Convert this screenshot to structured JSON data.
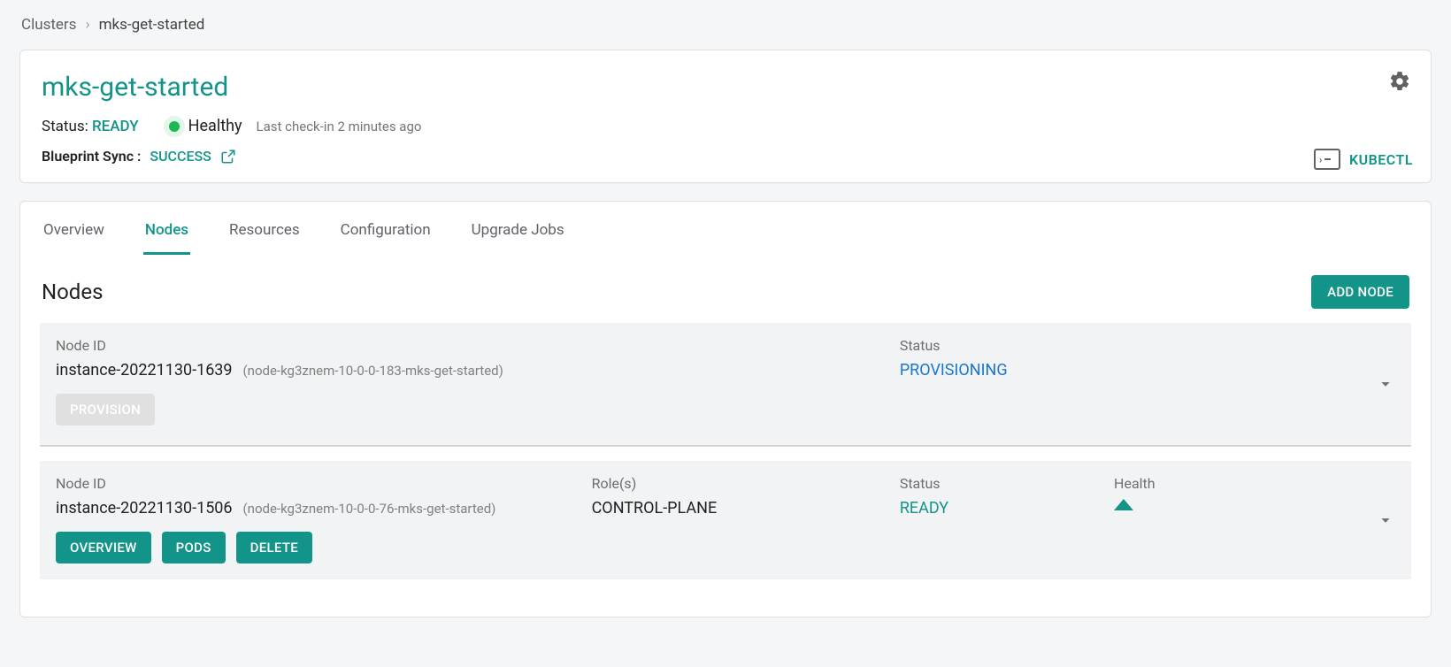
{
  "breadcrumb": {
    "root": "Clusters",
    "current": "mks-get-started"
  },
  "header": {
    "title": "mks-get-started",
    "status_label": "Status:",
    "status_value": "READY",
    "health_text": "Healthy",
    "checkin": "Last check-in 2 minutes ago",
    "blueprint_label": "Blueprint Sync :",
    "blueprint_value": "SUCCESS",
    "kubectl_label": "KUBECTL"
  },
  "tabs": {
    "items": [
      "Overview",
      "Nodes",
      "Resources",
      "Configuration",
      "Upgrade Jobs"
    ],
    "active_index": 1
  },
  "nodes_section": {
    "title": "Nodes",
    "add_btn": "ADD NODE",
    "labels": {
      "node_id": "Node ID",
      "roles": "Role(s)",
      "status": "Status",
      "health": "Health"
    },
    "nodes": [
      {
        "id": "instance-20221130-1639",
        "sub": "(node-kg3znem-10-0-0-183-mks-get-started)",
        "status": "PROVISIONING",
        "status_kind": "provisioning",
        "roles": "",
        "actions": {
          "provision": "PROVISION"
        }
      },
      {
        "id": "instance-20221130-1506",
        "sub": "(node-kg3znem-10-0-0-76-mks-get-started)",
        "roles": "CONTROL-PLANE",
        "status": "READY",
        "status_kind": "ready",
        "health": "up",
        "actions": {
          "overview": "OVERVIEW",
          "pods": "PODS",
          "delete": "DELETE"
        }
      }
    ]
  },
  "icons": {
    "gear": "gear-icon",
    "external": "external-link-icon",
    "terminal": "terminal-icon",
    "chevron_down": "chevron-down-icon"
  }
}
